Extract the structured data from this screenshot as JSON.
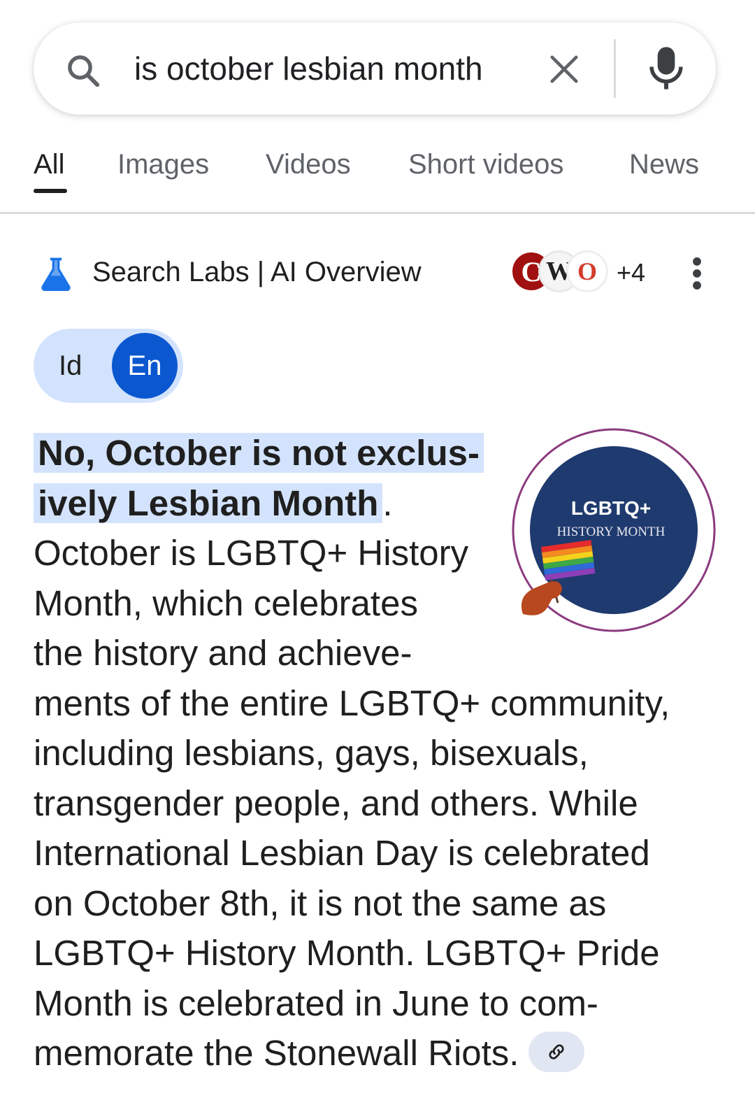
{
  "search": {
    "query": "is october lesbian month",
    "icons": {
      "search": "search-icon",
      "clear": "close-icon",
      "voice": "mic-icon"
    }
  },
  "tabs": [
    {
      "label": "All",
      "active": true
    },
    {
      "label": "Images",
      "active": false
    },
    {
      "label": "Videos",
      "active": false
    },
    {
      "label": "Short videos",
      "active": false
    },
    {
      "label": "News",
      "active": false
    }
  ],
  "ai_overview": {
    "title": "Search Labs | AI Overview",
    "sources": {
      "avatars": [
        "C",
        "W",
        "O"
      ],
      "more_count": "+4"
    },
    "language": {
      "option1": "Id",
      "option2": "En",
      "selected": "En"
    }
  },
  "answer": {
    "lines": [
      "No, October is not exclus-",
      "ively Lesbian Month",
      ".",
      "October is LGBTQ+ History",
      "Month, which celebrates",
      "the history and achieve-",
      "ments of the entire LGBTQ+ community,",
      "including lesbians, gays, bisexuals,",
      "transgender people, and others. While",
      "International Lesbian Day is celebrated",
      "on October 8th, it is not the same as",
      "LGBTQ+ History Month. LGBTQ+ Pride",
      "Month is celebrated in June to com-",
      "memorate the Stonewall Riots."
    ]
  },
  "thumbnail": {
    "line1": "LGBTQ+",
    "line2": "HISTORY MONTH",
    "colors": {
      "circle": "#1f3a6e",
      "ring": "#8b3a7e"
    }
  },
  "colors": {
    "highlight": "#d3e3fd",
    "accent": "#0b57d0",
    "text": "#1f1f1f",
    "muted": "#5f6368"
  }
}
